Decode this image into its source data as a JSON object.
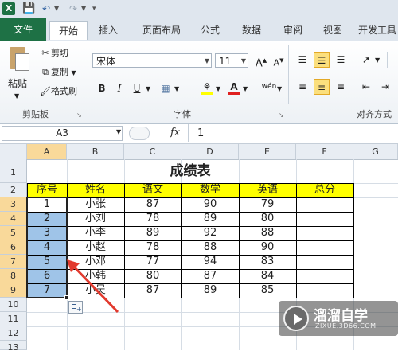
{
  "quick_access": {
    "logo_letter": "X"
  },
  "tabs": {
    "file": "文件",
    "home": "开始",
    "insert": "插入",
    "page_layout": "页面布局",
    "formulas": "公式",
    "data": "数据",
    "review": "审阅",
    "view": "视图",
    "developer": "开发工具"
  },
  "ribbon": {
    "paste": "粘贴",
    "cut": "剪切",
    "copy": "复制",
    "format_painter": "格式刷",
    "clipboard_group": "剪贴板",
    "font_name": "宋体",
    "font_size": "11",
    "font_group": "字体",
    "align_group": "对齐方式",
    "bold": "B",
    "italic": "I",
    "underline": "U",
    "grow_font": "A",
    "shrink_font": "A",
    "font_color_letter": "A",
    "phonetic": "wén"
  },
  "formula_bar": {
    "name_box": "A3",
    "fx": "fx",
    "value": "1"
  },
  "columns": [
    "A",
    "B",
    "C",
    "D",
    "E",
    "F",
    "G"
  ],
  "rows": [
    "1",
    "2",
    "3",
    "4",
    "5",
    "6",
    "7",
    "8",
    "9",
    "10",
    "11",
    "12",
    "13"
  ],
  "sheet": {
    "title": "成绩表",
    "headers": [
      "序号",
      "姓名",
      "语文",
      "数学",
      "英语",
      "总分"
    ],
    "records": [
      [
        "1",
        "小张",
        "87",
        "90",
        "79",
        ""
      ],
      [
        "2",
        "小刘",
        "78",
        "89",
        "80",
        ""
      ],
      [
        "3",
        "小李",
        "89",
        "92",
        "88",
        ""
      ],
      [
        "4",
        "小赵",
        "78",
        "88",
        "90",
        ""
      ],
      [
        "5",
        "小邓",
        "77",
        "94",
        "83",
        ""
      ],
      [
        "6",
        "小韩",
        "80",
        "87",
        "84",
        ""
      ],
      [
        "7",
        "小吴",
        "87",
        "89",
        "85",
        ""
      ]
    ]
  },
  "watermark": {
    "brand": "溜溜自学",
    "url": "ZIXUE.3D66.COM"
  },
  "colors": {
    "excel_green": "#1e7145",
    "header_yellow": "#ffff00",
    "selection_blue": "#9fc4e8",
    "arrow_red": "#e23a2e"
  }
}
